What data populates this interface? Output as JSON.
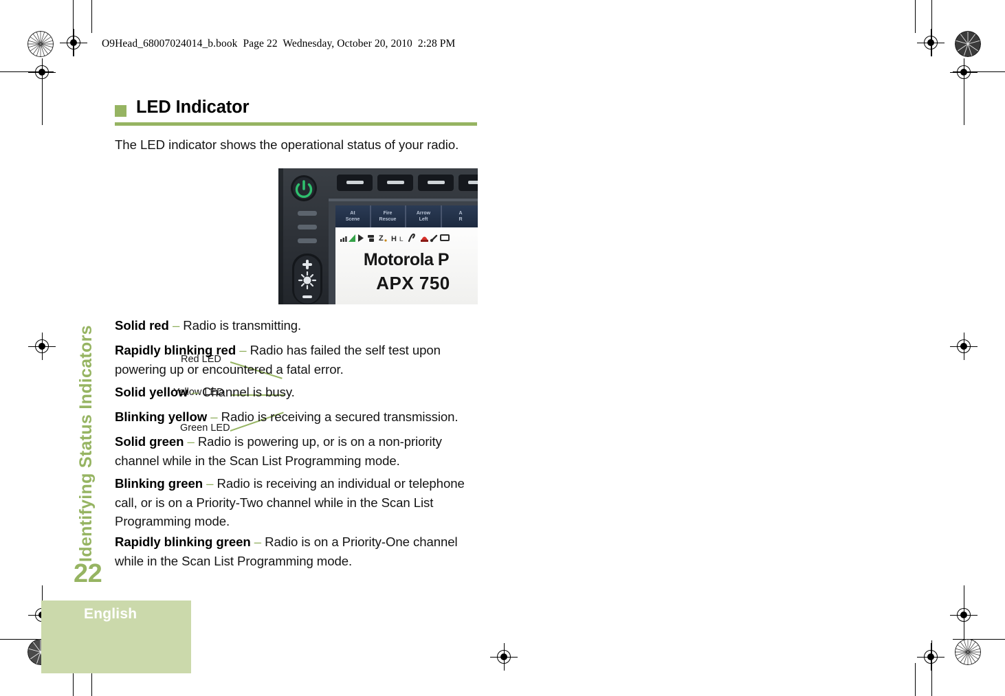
{
  "document": {
    "book_header": "O9Head_68007024014_b.book  Page 22  Wednesday, October 20, 2010  2:28 PM",
    "running_head": "Identifying Status Indicators",
    "page_number": "22",
    "language_tab": "English",
    "accent_green": "#96b462",
    "tab_green": "#cbd9ab"
  },
  "section": {
    "heading": "LED Indicator",
    "intro": "The LED indicator shows the operational status of your radio."
  },
  "figure": {
    "callouts": [
      {
        "label": "Red LED"
      },
      {
        "label": "Yellow LED"
      },
      {
        "label": "Green LED"
      }
    ],
    "radio": {
      "brand_line": "Motorola P",
      "model_line": "APX 750",
      "softkeys": [
        "At Scene",
        "Fire Rescue",
        "Arrow Left",
        "A"
      ],
      "status_icons": [
        "signal-strength-icon",
        "play-icon",
        "scan-icon",
        "zone-icon",
        "hi-icon",
        "low-icon",
        "monitor-icon",
        "alert-icon",
        "phone-icon",
        "message-icon"
      ]
    }
  },
  "led_states": [
    {
      "term": "Solid red",
      "dash": "–",
      "desc": "Radio is transmitting."
    },
    {
      "term": "Rapidly blinking red",
      "dash": "–",
      "desc": "Radio has failed the self test upon powering up or encountered a fatal error."
    },
    {
      "term": "Solid yellow",
      "dash": "–",
      "desc": "Channel is busy."
    },
    {
      "term": "Blinking yellow",
      "dash": "–",
      "desc": "Radio is receiving a secured transmission."
    },
    {
      "term": "Solid green",
      "dash": "–",
      "desc": "Radio is powering up, or is on a non-priority channel while in the Scan List Programming mode."
    },
    {
      "term": "Blinking green",
      "dash": "–",
      "desc": "Radio is receiving an individual or telephone call, or is on a Priority-Two channel while in the Scan List Programming mode."
    },
    {
      "term": "Rapidly blinking green",
      "dash": "–",
      "desc": "Radio is on a Priority-One channel while in the Scan List Programming mode."
    }
  ]
}
